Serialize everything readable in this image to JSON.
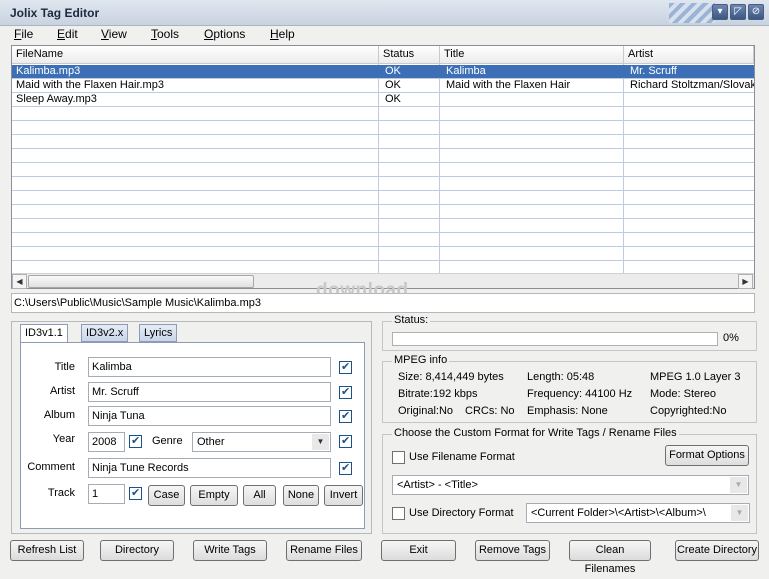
{
  "window": {
    "title": "Jolix Tag Editor"
  },
  "menu": [
    "File",
    "Edit",
    "View",
    "Tools",
    "Options",
    "Help"
  ],
  "filelist": {
    "columns": [
      "FileName",
      "Status",
      "Title",
      "Artist"
    ],
    "rows": [
      {
        "file": "Kalimba.mp3",
        "status": "OK",
        "title": "Kalimba",
        "artist": "Mr. Scruff",
        "selected": true
      },
      {
        "file": "Maid with the Flaxen Hair.mp3",
        "status": "OK",
        "title": "Maid with the Flaxen Hair",
        "artist": "Richard Stoltzman/Slovak"
      },
      {
        "file": "Sleep Away.mp3",
        "status": "OK",
        "title": "",
        "artist": ""
      }
    ]
  },
  "path": "C:\\Users\\Public\\Music\\Sample Music\\Kalimba.mp3",
  "watermark": "download",
  "tags": {
    "tabs": [
      "ID3v1.1",
      "ID3v2.x",
      "Lyrics"
    ],
    "labels": {
      "title": "Title",
      "artist": "Artist",
      "album": "Album",
      "year": "Year",
      "genre": "Genre",
      "comment": "Comment",
      "track": "Track"
    },
    "values": {
      "title": "Kalimba",
      "artist": "Mr. Scruff",
      "album": "Ninja Tuna",
      "year": "2008",
      "genre": "Other",
      "comment": "Ninja Tune Records",
      "track": "1"
    },
    "buttons": {
      "case": "Case",
      "empty": "Empty",
      "all": "All",
      "none": "None",
      "invert": "Invert"
    }
  },
  "status": {
    "label": "Status:",
    "percent": "0%",
    "progress": 0
  },
  "mpeg": {
    "label": "MPEG info",
    "size": "Size: 8,414,449 bytes",
    "length": "Length:  05:48",
    "layer": "MPEG 1.0 Layer 3",
    "bitrate": "Bitrate:192 kbps",
    "frequency": "Frequency: 44100 Hz",
    "mode": "Mode: Stereo",
    "original": "Original:No",
    "crcs": "CRCs: No",
    "emphasis": "Emphasis: None",
    "copyrighted": "Copyrighted:No"
  },
  "custom": {
    "label": "Choose the Custom Format for Write Tags / Rename Files",
    "use_filename": "Use Filename Format",
    "format_options": "Format Options",
    "filename_format": "<Artist> - <Title>",
    "use_directory": "Use Directory Format",
    "directory_format": "<Current Folder>\\<Artist>\\<Album>\\"
  },
  "bottom_buttons": [
    "Refresh List",
    "Directory",
    "Write Tags",
    "Rename Files",
    "Exit",
    "Remove Tags",
    "Clean Filenames",
    "Create Directory"
  ]
}
